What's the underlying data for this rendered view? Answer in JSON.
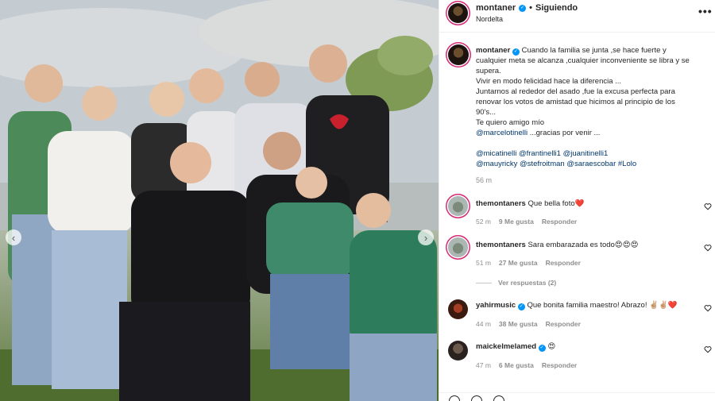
{
  "post": {
    "username": "montaner",
    "separator": "•",
    "follow_status": "Siguiendo",
    "location": "Nordelta",
    "more_icon": "•••",
    "caption_lines": [
      "Cuando la familia se junta ,se hace fuerte y",
      "cualquier meta se alcanza ,cualquier inconveniente se libra y se",
      "supera.",
      "Vivir en modo felicidad hace la diferencia ...",
      "Juntarnos al rededor del asado ,fue la excusa perfecta para",
      "renovar los votos de amistad que hicimos al principio de los",
      "90's...",
      "Te quiero amigo mío",
      "...gracias por venir ..."
    ],
    "caption_mention": "@marcelotinelli",
    "hashtags_line1": "@micatinelli @frantinelli1 @juanitinelli1",
    "hashtags_line2": "@mauyricky @stefroitman @saraescobar #Lolo",
    "time": "56 m"
  },
  "comments": [
    {
      "username": "themontaners",
      "text": "Que bella foto❤️",
      "time": "52 m",
      "likes": "9 Me gusta",
      "reply": "Responder"
    },
    {
      "username": "themontaners",
      "text": "Sara embarazada es todo😍😍😍",
      "time": "51 m",
      "likes": "27 Me gusta",
      "reply": "Responder",
      "view_replies": "Ver respuestas (2)"
    },
    {
      "username": "yahirmusic",
      "text": "Que bonita familia maestro! Abrazo! ✌🏼✌🏼❤️",
      "time": "44 m",
      "likes": "38 Me gusta",
      "reply": "Responder"
    },
    {
      "username": "maickelmelamed",
      "text": "😍",
      "time": "47 m",
      "likes": "6 Me gusta",
      "reply": "Responder"
    }
  ],
  "colors": {
    "verified": "#0095f6",
    "link": "#00376b",
    "muted": "#8e8e8e",
    "story_ring": "#d62976"
  },
  "icons": {
    "nav_prev": "‹",
    "nav_next": "›",
    "heart": "heart-outline"
  }
}
